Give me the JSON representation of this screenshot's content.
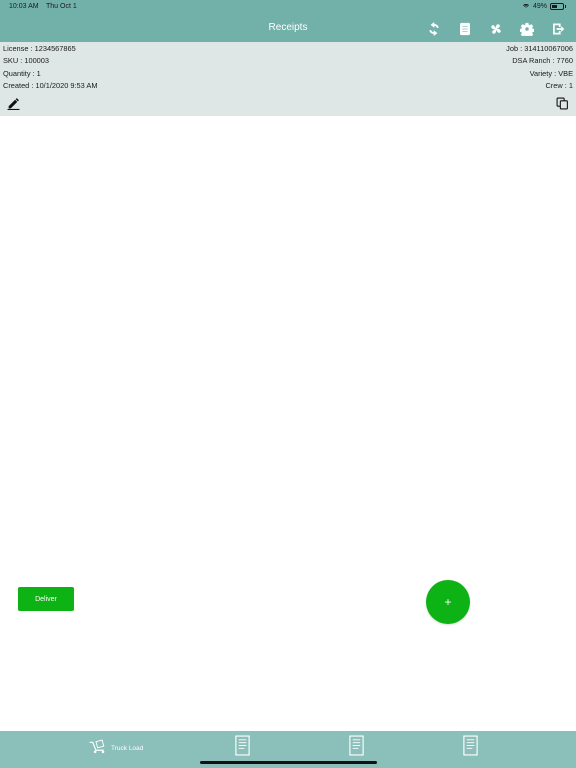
{
  "status_bar": {
    "time": "10:03 AM",
    "date": "Thu Oct 1",
    "battery": "49%"
  },
  "nav": {
    "title": "Receipts",
    "icons": [
      "refresh-icon",
      "document-list-icon",
      "fan-icon",
      "settings-gear-icon",
      "logout-icon"
    ]
  },
  "info": {
    "license": "License :  1234567865",
    "job": "Job :  314110067006",
    "sku": "SKU :  100003",
    "ranch": "DSA Ranch :  7760",
    "quantity": "Quantity :  1",
    "variety": "Variety :  VBE",
    "created": "Created :  10/1/2020 9:53 AM",
    "crew": "Crew :  1"
  },
  "actions": {
    "deliver_label": "Deliver",
    "fab_label": "+"
  },
  "tabbar": {
    "tabs": [
      {
        "label": "Truck Load",
        "icon": "truck-load-icon"
      },
      {
        "label": "",
        "icon": "receipt-doc-icon"
      },
      {
        "label": "",
        "icon": "receipt-doc-icon"
      },
      {
        "label": "",
        "icon": "receipt-doc-icon"
      }
    ]
  },
  "colors": {
    "header": "#72b1a9",
    "info_bg": "#dfe7e6",
    "accent_green": "#0db214",
    "tabbar": "#8bbfba"
  }
}
